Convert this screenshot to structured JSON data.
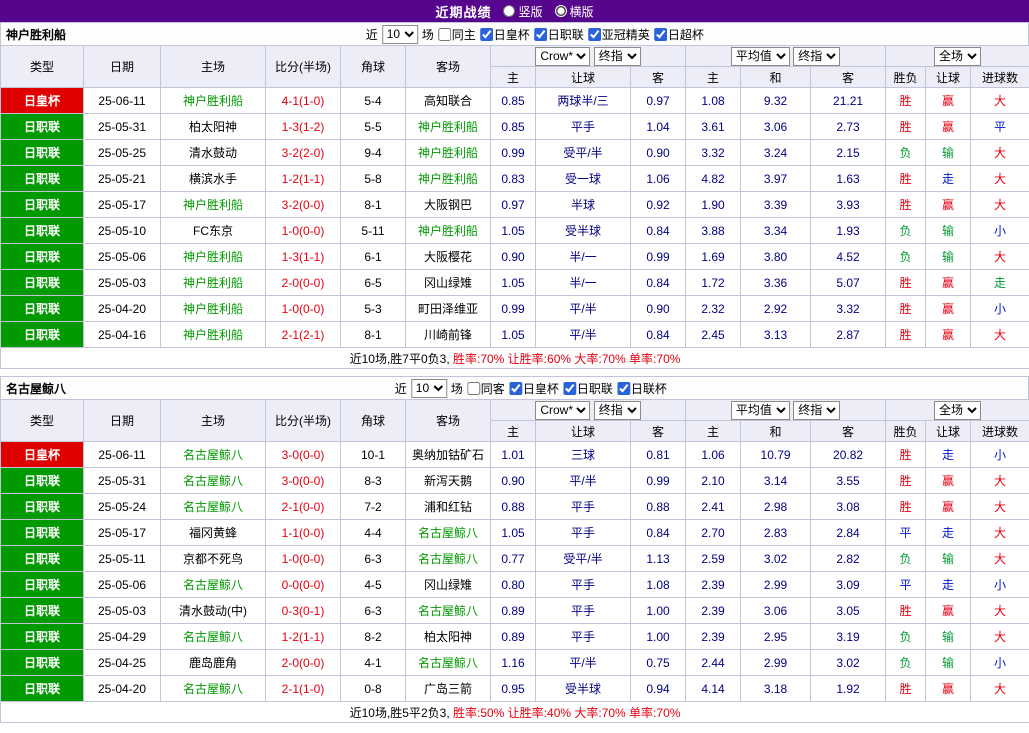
{
  "topbar": {
    "title": "近期战绩",
    "radios": [
      {
        "label": "竖版",
        "selected": false
      },
      {
        "label": "横版",
        "selected": true
      }
    ]
  },
  "filter_prefix": "近",
  "filter_suffix": "场",
  "header": {
    "cols": [
      "类型",
      "日期",
      "主场",
      "比分(半场)",
      "角球",
      "客场"
    ],
    "group1": {
      "selects": [
        "Crow*",
        "终指"
      ],
      "cols": [
        "主",
        "让球",
        "客"
      ]
    },
    "group2": {
      "selects": [
        "平均值",
        "终指"
      ],
      "cols": [
        "主",
        "和",
        "客"
      ]
    },
    "group3": {
      "selects": [
        "全场"
      ],
      "cols": [
        "胜负",
        "让球",
        "进球数"
      ]
    }
  },
  "tables": [
    {
      "team": "神户胜利船",
      "matches": "10",
      "checkboxes": [
        {
          "label": "同主",
          "checked": false
        },
        {
          "label": "日皇杯",
          "checked": true
        },
        {
          "label": "日职联",
          "checked": true
        },
        {
          "label": "亚冠精英",
          "checked": true
        },
        {
          "label": "日超杯",
          "checked": true
        }
      ],
      "rows": [
        {
          "league": "日皇杯",
          "date": "25-06-11",
          "home": "神户胜利船",
          "away": "高知联合",
          "focal": "home",
          "score": "4-1(1-0)",
          "corners": "5-4",
          "odds": [
            "0.85",
            "两球半/三",
            "0.97"
          ],
          "avg": [
            "1.08",
            "9.32",
            "21.21"
          ],
          "results": [
            "胜",
            "赢",
            "大"
          ]
        },
        {
          "league": "日职联",
          "date": "25-05-31",
          "home": "柏太阳神",
          "away": "神户胜利船",
          "focal": "away",
          "score": "1-3(1-2)",
          "corners": "5-5",
          "odds": [
            "0.85",
            "平手",
            "1.04"
          ],
          "avg": [
            "3.61",
            "3.06",
            "2.73"
          ],
          "results": [
            "胜",
            "赢",
            "平"
          ]
        },
        {
          "league": "日职联",
          "date": "25-05-25",
          "home": "清水鼓动",
          "away": "神户胜利船",
          "focal": "away",
          "score": "3-2(2-0)",
          "corners": "9-4",
          "odds": [
            "0.99",
            "受平/半",
            "0.90"
          ],
          "avg": [
            "3.32",
            "3.24",
            "2.15"
          ],
          "results": [
            "负",
            "输",
            "大"
          ]
        },
        {
          "league": "日职联",
          "date": "25-05-21",
          "home": "横滨水手",
          "away": "神户胜利船",
          "focal": "away",
          "score": "1-2(1-1)",
          "corners": "5-8",
          "odds": [
            "0.83",
            "受一球",
            "1.06"
          ],
          "avg": [
            "4.82",
            "3.97",
            "1.63"
          ],
          "results": [
            "胜",
            "走",
            "大"
          ]
        },
        {
          "league": "日职联",
          "date": "25-05-17",
          "home": "神户胜利船",
          "away": "大阪钢巴",
          "focal": "home",
          "score": "3-2(0-0)",
          "corners": "8-1",
          "odds": [
            "0.97",
            "半球",
            "0.92"
          ],
          "avg": [
            "1.90",
            "3.39",
            "3.93"
          ],
          "results": [
            "胜",
            "赢",
            "大"
          ]
        },
        {
          "league": "日职联",
          "date": "25-05-10",
          "home": "FC东京",
          "away": "神户胜利船",
          "focal": "away",
          "score": "1-0(0-0)",
          "corners": "5-11",
          "odds": [
            "1.05",
            "受半球",
            "0.84"
          ],
          "avg": [
            "3.88",
            "3.34",
            "1.93"
          ],
          "results": [
            "负",
            "输",
            "小"
          ]
        },
        {
          "league": "日职联",
          "date": "25-05-06",
          "home": "神户胜利船",
          "away": "大阪樱花",
          "focal": "home",
          "score": "1-3(1-1)",
          "corners": "6-1",
          "odds": [
            "0.90",
            "半/一",
            "0.99"
          ],
          "avg": [
            "1.69",
            "3.80",
            "4.52"
          ],
          "results": [
            "负",
            "输",
            "大"
          ]
        },
        {
          "league": "日职联",
          "date": "25-05-03",
          "home": "神户胜利船",
          "away": "冈山绿雉",
          "focal": "home",
          "score": "2-0(0-0)",
          "corners": "6-5",
          "odds": [
            "1.05",
            "半/一",
            "0.84"
          ],
          "avg": [
            "1.72",
            "3.36",
            "5.07"
          ],
          "results": [
            "胜",
            "赢",
            "走"
          ]
        },
        {
          "league": "日职联",
          "date": "25-04-20",
          "home": "神户胜利船",
          "away": "町田泽维亚",
          "focal": "home",
          "score": "1-0(0-0)",
          "corners": "5-3",
          "odds": [
            "0.99",
            "平/半",
            "0.90"
          ],
          "avg": [
            "2.32",
            "2.92",
            "3.32"
          ],
          "results": [
            "胜",
            "赢",
            "小"
          ]
        },
        {
          "league": "日职联",
          "date": "25-04-16",
          "home": "神户胜利船",
          "away": "川崎前锋",
          "focal": "home",
          "score": "2-1(2-1)",
          "corners": "8-1",
          "odds": [
            "1.05",
            "平/半",
            "0.84"
          ],
          "avg": [
            "2.45",
            "3.13",
            "2.87"
          ],
          "results": [
            "胜",
            "赢",
            "大"
          ]
        }
      ],
      "summary": {
        "text": "近10场,胜7平0负3,",
        "stats": "胜率:70% 让胜率:60% 大率:70% 单率:70%"
      }
    },
    {
      "team": "名古屋鲸八",
      "matches": "10",
      "checkboxes": [
        {
          "label": "同客",
          "checked": false
        },
        {
          "label": "日皇杯",
          "checked": true
        },
        {
          "label": "日职联",
          "checked": true
        },
        {
          "label": "日联杯",
          "checked": true
        }
      ],
      "rows": [
        {
          "league": "日皇杯",
          "date": "25-06-11",
          "home": "名古屋鲸八",
          "away": "奥纳加钴矿石",
          "focal": "home",
          "score": "3-0(0-0)",
          "corners": "10-1",
          "odds": [
            "1.01",
            "三球",
            "0.81"
          ],
          "avg": [
            "1.06",
            "10.79",
            "20.82"
          ],
          "results": [
            "胜",
            "走",
            "小"
          ]
        },
        {
          "league": "日职联",
          "date": "25-05-31",
          "home": "名古屋鲸八",
          "away": "新泻天鹅",
          "focal": "home",
          "score": "3-0(0-0)",
          "corners": "8-3",
          "odds": [
            "0.90",
            "平/半",
            "0.99"
          ],
          "avg": [
            "2.10",
            "3.14",
            "3.55"
          ],
          "results": [
            "胜",
            "赢",
            "大"
          ]
        },
        {
          "league": "日职联",
          "date": "25-05-24",
          "home": "名古屋鲸八",
          "away": "浦和红钻",
          "focal": "home",
          "score": "2-1(0-0)",
          "corners": "7-2",
          "odds": [
            "0.88",
            "平手",
            "0.88"
          ],
          "avg": [
            "2.41",
            "2.98",
            "3.08"
          ],
          "results": [
            "胜",
            "赢",
            "大"
          ]
        },
        {
          "league": "日职联",
          "date": "25-05-17",
          "home": "福冈黄蜂",
          "away": "名古屋鲸八",
          "focal": "away",
          "score": "1-1(0-0)",
          "corners": "4-4",
          "odds": [
            "1.05",
            "平手",
            "0.84"
          ],
          "avg": [
            "2.70",
            "2.83",
            "2.84"
          ],
          "results": [
            "平",
            "走",
            "大"
          ]
        },
        {
          "league": "日职联",
          "date": "25-05-11",
          "home": "京都不死鸟",
          "away": "名古屋鲸八",
          "focal": "away",
          "score": "1-0(0-0)",
          "corners": "6-3",
          "odds": [
            "0.77",
            "受平/半",
            "1.13"
          ],
          "avg": [
            "2.59",
            "3.02",
            "2.82"
          ],
          "results": [
            "负",
            "输",
            "大"
          ]
        },
        {
          "league": "日职联",
          "date": "25-05-06",
          "home": "名古屋鲸八",
          "away": "冈山绿雉",
          "focal": "home",
          "score": "0-0(0-0)",
          "corners": "4-5",
          "odds": [
            "0.80",
            "平手",
            "1.08"
          ],
          "avg": [
            "2.39",
            "2.99",
            "3.09"
          ],
          "results": [
            "平",
            "走",
            "小"
          ]
        },
        {
          "league": "日职联",
          "date": "25-05-03",
          "home": "清水鼓动(中)",
          "away": "名古屋鲸八",
          "focal": "away",
          "score": "0-3(0-1)",
          "corners": "6-3",
          "odds": [
            "0.89",
            "平手",
            "1.00"
          ],
          "avg": [
            "2.39",
            "3.06",
            "3.05"
          ],
          "results": [
            "胜",
            "赢",
            "大"
          ]
        },
        {
          "league": "日职联",
          "date": "25-04-29",
          "home": "名古屋鲸八",
          "away": "柏太阳神",
          "focal": "home",
          "score": "1-2(1-1)",
          "corners": "8-2",
          "odds": [
            "0.89",
            "平手",
            "1.00"
          ],
          "avg": [
            "2.39",
            "2.95",
            "3.19"
          ],
          "results": [
            "负",
            "输",
            "大"
          ]
        },
        {
          "league": "日职联",
          "date": "25-04-25",
          "home": "鹿岛鹿角",
          "away": "名古屋鲸八",
          "focal": "away",
          "score": "2-0(0-0)",
          "corners": "4-1",
          "odds": [
            "1.16",
            "平/半",
            "0.75"
          ],
          "avg": [
            "2.44",
            "2.99",
            "3.02"
          ],
          "results": [
            "负",
            "输",
            "小"
          ]
        },
        {
          "league": "日职联",
          "date": "25-04-20",
          "home": "名古屋鲸八",
          "away": "广岛三箭",
          "focal": "home",
          "score": "2-1(1-0)",
          "corners": "0-8",
          "odds": [
            "0.95",
            "受半球",
            "0.94"
          ],
          "avg": [
            "4.14",
            "3.18",
            "1.92"
          ],
          "results": [
            "胜",
            "赢",
            "大"
          ]
        }
      ],
      "summary": {
        "text": "近10场,胜5平2负3,",
        "stats": "胜率:50% 让胜率:40% 大率:70% 单率:70%"
      }
    }
  ],
  "colors": {
    "topbar_bg": "#56068D",
    "header_bg": "#EDEDF8",
    "border": "#C3C3D9",
    "score": "#E60012",
    "focal_team": "#009900",
    "odds_text": "#000080",
    "league_bg": {
      "日皇杯": "#E10000",
      "日职联": "#009A00"
    },
    "red": "#E60012",
    "green": "#009933",
    "blue": "#0017CC",
    "result_maps": {
      "winlose": {
        "胜": "red",
        "平": "blue",
        "负": "green"
      },
      "handicap": {
        "赢": "red",
        "走": "blue",
        "输": "green"
      },
      "goals": {
        "大": "red",
        "走": "green",
        "小": "blue",
        "平": "blue"
      }
    }
  }
}
